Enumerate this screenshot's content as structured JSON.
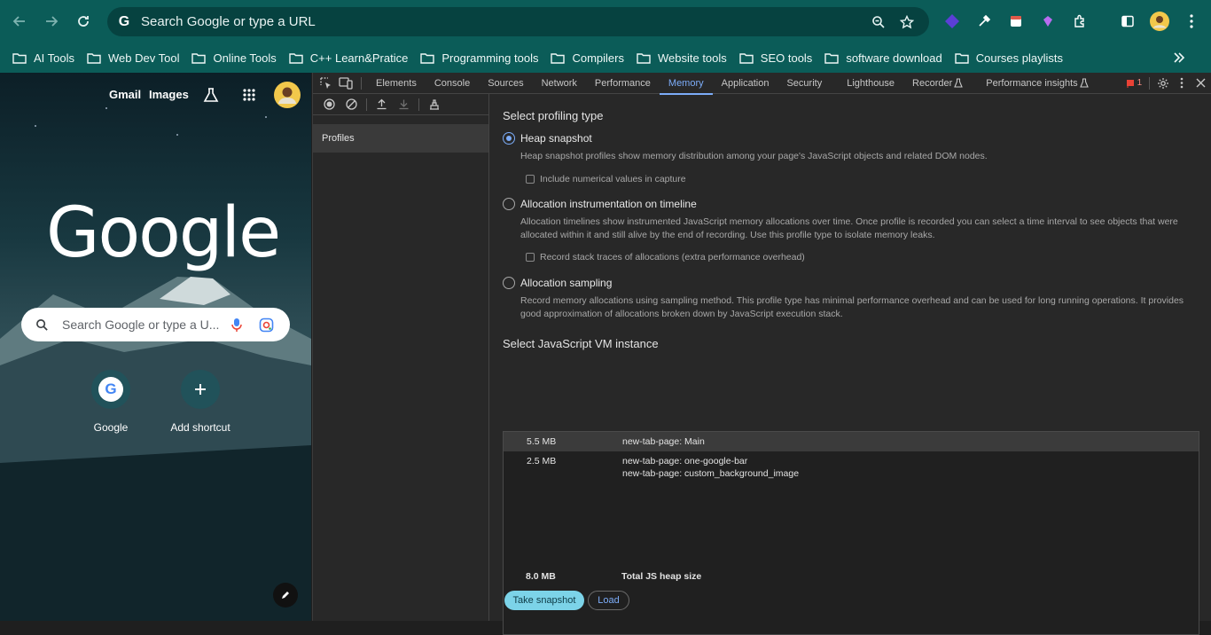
{
  "omnibox": {
    "text": "Search Google or type a URL"
  },
  "bookmarks": [
    "AI Tools",
    "Web Dev Tool",
    "Online Tools",
    "C++ Learn&Pratice",
    "Programming tools",
    "Compilers",
    "Website tools",
    "SEO tools",
    "software download",
    "Courses playlists"
  ],
  "ntp": {
    "gmail": "Gmail",
    "images": "Images",
    "logo": "Google",
    "search_placeholder": "Search Google or type a U...",
    "shortcuts": [
      {
        "label": "Google"
      },
      {
        "label": "Add shortcut"
      }
    ]
  },
  "devtools": {
    "tabs": [
      "Elements",
      "Console",
      "Sources",
      "Network",
      "Performance",
      "Memory",
      "Application",
      "Security",
      "Lighthouse",
      "Recorder",
      "Performance insights"
    ],
    "active_tab": "Memory",
    "issues_count": "1",
    "sidebar": {
      "profiles": "Profiles"
    },
    "main": {
      "select_profiling_type": "Select profiling type",
      "heap_snapshot": {
        "label": "Heap snapshot",
        "desc": "Heap snapshot profiles show memory distribution among your page's JavaScript objects and related DOM nodes.",
        "option": "Include numerical values in capture"
      },
      "allocation_timeline": {
        "label": "Allocation instrumentation on timeline",
        "desc": "Allocation timelines show instrumented JavaScript memory allocations over time. Once profile is recorded you can select a time interval to see objects that were allocated within it and still alive by the end of recording. Use this profile type to isolate memory leaks.",
        "option": "Record stack traces of allocations (extra performance overhead)"
      },
      "allocation_sampling": {
        "label": "Allocation sampling",
        "desc": "Record memory allocations using sampling method. This profile type has minimal performance overhead and can be used for long running operations. It provides good approximation of allocations broken down by JavaScript execution stack."
      },
      "select_vm": "Select JavaScript VM instance",
      "vm_rows": [
        {
          "size": "5.5 MB",
          "name": "new-tab-page: Main",
          "name2": ""
        },
        {
          "size": "2.5 MB",
          "name": "new-tab-page: one-google-bar",
          "name2": "new-tab-page: custom_background_image"
        }
      ],
      "total_size": "8.0 MB",
      "total_label": "Total JS heap size",
      "take_snapshot": "Take snapshot",
      "load": "Load"
    }
  }
}
